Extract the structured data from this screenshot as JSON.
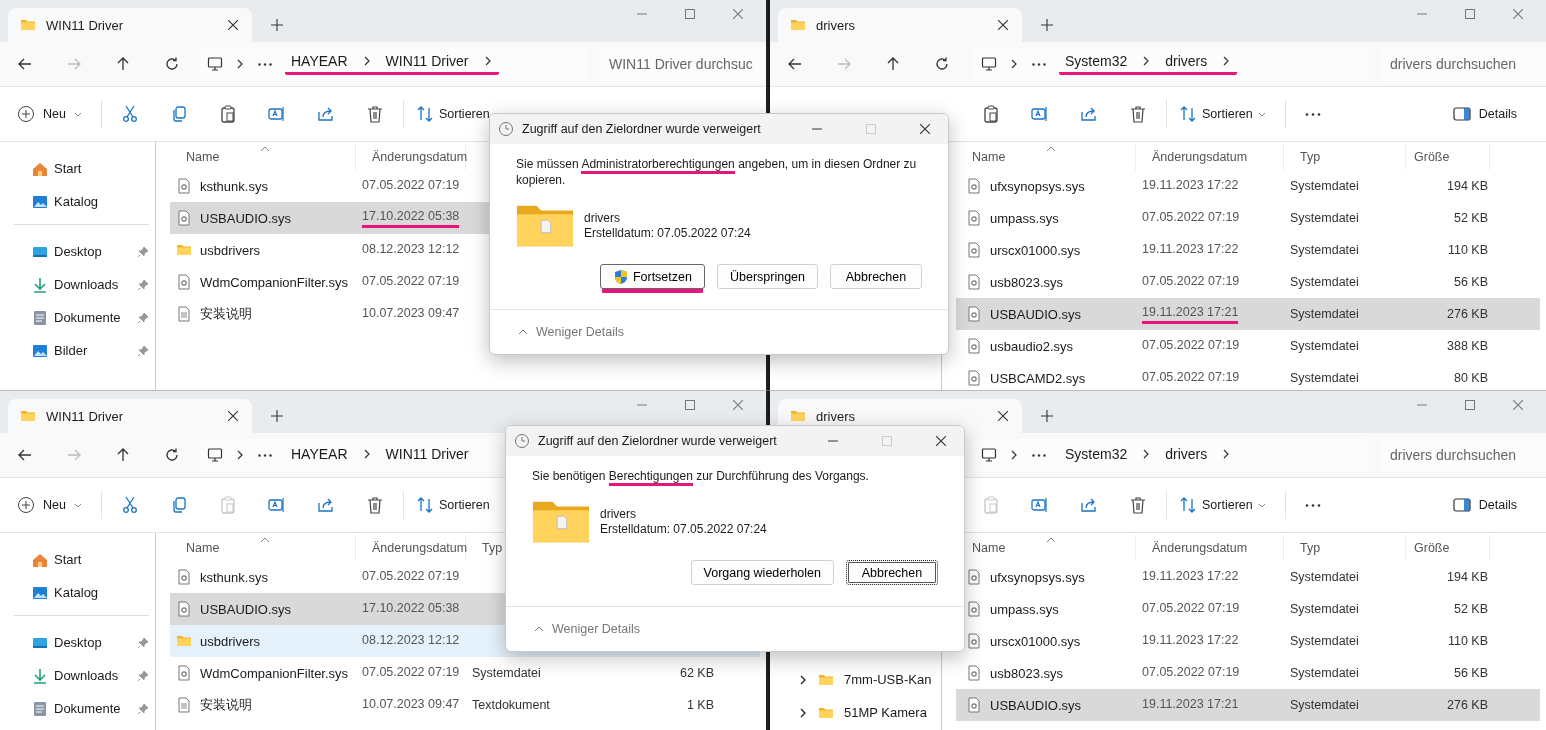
{
  "windows": [
    {
      "tab_title": "WIN11 Driver",
      "breadcrumb": {
        "items": [
          "HAYEAR",
          "WIN11 Driver"
        ],
        "trailing_chevron": true,
        "marked": true
      },
      "search_placeholder": "WIN11 Driver durchsuc",
      "toolbar": [
        {
          "kind": "new",
          "label": "Neu"
        },
        {
          "kind": "cut"
        },
        {
          "kind": "copy"
        },
        {
          "kind": "paste",
          "disabled": false
        },
        {
          "kind": "rename"
        },
        {
          "kind": "share"
        },
        {
          "kind": "delete"
        },
        {
          "kind": "sort",
          "label": "Sortieren"
        }
      ],
      "sidebar": [
        [
          {
            "label": "Start",
            "pinned": false
          },
          {
            "label": "Katalog",
            "pinned": false
          }
        ],
        [
          {
            "label": "Desktop",
            "pinned": true
          },
          {
            "label": "Downloads",
            "pinned": true
          },
          {
            "label": "Dokumente",
            "pinned": true
          },
          {
            "label": "Bilder",
            "pinned": true
          }
        ]
      ],
      "columns": [
        "Name",
        "Änderungsdatum"
      ],
      "rows": [
        {
          "name": "ksthunk.sys",
          "kind": "sys",
          "date": "07.05.2022 07:19",
          "selected": false,
          "hovered": false,
          "date_marked": false
        },
        {
          "name": "USBAUDIO.sys",
          "kind": "sys",
          "date": "17.10.2022 05:38",
          "selected": true,
          "hovered": false,
          "date_marked": true
        },
        {
          "name": "usbdrivers",
          "kind": "folder",
          "date": "08.12.2023 12:12",
          "selected": false,
          "hovered": false,
          "date_marked": false
        },
        {
          "name": "WdmCompanionFilter.sys",
          "kind": "sys",
          "date": "07.05.2022 07:19",
          "selected": false,
          "hovered": false,
          "date_marked": false
        },
        {
          "name": "安装说明",
          "kind": "text",
          "date": "10.07.2023 09:47",
          "selected": false,
          "hovered": false,
          "date_marked": false
        }
      ]
    },
    {
      "tab_title": "drivers",
      "breadcrumb": {
        "items": [
          "System32",
          "drivers"
        ],
        "trailing_chevron": true,
        "marked": true
      },
      "search_placeholder": "drivers durchsuchen",
      "toolbar": [
        {
          "kind": "paste",
          "disabled": false
        },
        {
          "kind": "rename"
        },
        {
          "kind": "share"
        },
        {
          "kind": "delete"
        },
        {
          "kind": "sort",
          "label": "Sortieren"
        },
        {
          "kind": "more"
        },
        {
          "kind": "details",
          "label": "Details"
        }
      ],
      "columns": [
        "Name",
        "Änderungsdatum",
        "Typ",
        "Größe"
      ],
      "rows": [
        {
          "name": "ufxsynopsys.sys",
          "kind": "sys",
          "date": "19.11.2023 17:22",
          "type": "Systemdatei",
          "size": "194 KB",
          "selected": false,
          "hovered": false,
          "date_marked": false
        },
        {
          "name": "umpass.sys",
          "kind": "sys",
          "date": "07.05.2022 07:19",
          "type": "Systemdatei",
          "size": "52 KB",
          "selected": false,
          "hovered": false,
          "date_marked": false
        },
        {
          "name": "urscx01000.sys",
          "kind": "sys",
          "date": "19.11.2023 17:22",
          "type": "Systemdatei",
          "size": "110 KB",
          "selected": false,
          "hovered": false,
          "date_marked": false
        },
        {
          "name": "usb8023.sys",
          "kind": "sys",
          "date": "07.05.2022 07:19",
          "type": "Systemdatei",
          "size": "56 KB",
          "selected": false,
          "hovered": false,
          "date_marked": false
        },
        {
          "name": "USBAUDIO.sys",
          "kind": "sys",
          "date": "19.11.2023 17:21",
          "type": "Systemdatei",
          "size": "276 KB",
          "selected": true,
          "hovered": false,
          "date_marked": true
        },
        {
          "name": "usbaudio2.sys",
          "kind": "sys",
          "date": "07.05.2022 07:19",
          "type": "Systemdatei",
          "size": "388 KB",
          "selected": false,
          "hovered": false,
          "date_marked": false
        },
        {
          "name": "USBCAMD2.sys",
          "kind": "sys",
          "date": "07.05.2022 07:19",
          "type": "Systemdatei",
          "size": "80 KB",
          "selected": false,
          "hovered": false,
          "date_marked": false
        }
      ]
    },
    {
      "tab_title": "WIN11 Driver",
      "breadcrumb": {
        "items": [
          "HAYEAR",
          "WIN11 Driver"
        ],
        "trailing_chevron": false,
        "marked": false
      },
      "toolbar": [
        {
          "kind": "new",
          "label": "Neu"
        },
        {
          "kind": "cut"
        },
        {
          "kind": "copy"
        },
        {
          "kind": "paste",
          "disabled": true
        },
        {
          "kind": "rename"
        },
        {
          "kind": "share"
        },
        {
          "kind": "delete"
        },
        {
          "kind": "sort",
          "label": "Sortieren"
        }
      ],
      "sidebar": [
        [
          {
            "label": "Start",
            "pinned": false
          },
          {
            "label": "Katalog",
            "pinned": false
          }
        ],
        [
          {
            "label": "Desktop",
            "pinned": true
          },
          {
            "label": "Downloads",
            "pinned": true
          },
          {
            "label": "Dokumente",
            "pinned": true
          }
        ]
      ],
      "columns": [
        "Name",
        "Änderungsdatum",
        "Typ"
      ],
      "rows": [
        {
          "name": "ksthunk.sys",
          "kind": "sys",
          "date": "07.05.2022 07:19",
          "selected": false,
          "hovered": false,
          "date_marked": false
        },
        {
          "name": "USBAUDIO.sys",
          "kind": "sys",
          "date": "17.10.2022 05:38",
          "selected": true,
          "hovered": false,
          "date_marked": false
        },
        {
          "name": "usbdrivers",
          "kind": "folder",
          "date": "08.12.2023 12:12",
          "selected": false,
          "hovered": true,
          "date_marked": false
        },
        {
          "name": "WdmCompanionFilter.sys",
          "kind": "sys",
          "date": "07.05.2022 07:19",
          "type": "Systemdatei",
          "size": "62 KB",
          "selected": false,
          "hovered": false,
          "date_marked": false
        },
        {
          "name": "安装说明",
          "kind": "text",
          "date": "10.07.2023 09:47",
          "type": "Textdokument",
          "size": "1 KB",
          "selected": false,
          "hovered": false,
          "date_marked": false
        }
      ]
    },
    {
      "tab_title": "drivers",
      "breadcrumb": {
        "items": [
          "System32",
          "drivers"
        ],
        "trailing_chevron": true,
        "marked": false
      },
      "search_placeholder": "drivers durchsuchen",
      "toolbar": [
        {
          "kind": "paste",
          "disabled": true
        },
        {
          "kind": "rename"
        },
        {
          "kind": "share"
        },
        {
          "kind": "delete"
        },
        {
          "kind": "sort",
          "label": "Sortieren"
        },
        {
          "kind": "more"
        },
        {
          "kind": "details",
          "label": "Details"
        }
      ],
      "sidebar": [
        [
          {
            "label": "7mm-USB-Kan",
            "pinned": false,
            "expandable": true
          },
          {
            "label": "51MP Kamera",
            "pinned": false,
            "expandable": true
          }
        ]
      ],
      "columns": [
        "Name",
        "Änderungsdatum",
        "Typ",
        "Größe"
      ],
      "rows": [
        {
          "name": "ufxsynopsys.sys",
          "kind": "sys",
          "date": "19.11.2023 17:22",
          "type": "Systemdatei",
          "size": "194 KB",
          "selected": false,
          "hovered": false,
          "date_marked": false
        },
        {
          "name": "umpass.sys",
          "kind": "sys",
          "date": "07.05.2022 07:19",
          "type": "Systemdatei",
          "size": "52 KB",
          "selected": false,
          "hovered": false,
          "date_marked": false
        },
        {
          "name": "urscx01000.sys",
          "kind": "sys",
          "date": "19.11.2023 17:22",
          "type": "Systemdatei",
          "size": "110 KB",
          "selected": false,
          "hovered": false,
          "date_marked": false
        },
        {
          "name": "usb8023.sys",
          "kind": "sys",
          "date": "07.05.2022 07:19",
          "type": "Systemdatei",
          "size": "56 KB",
          "selected": false,
          "hovered": false,
          "date_marked": false
        },
        {
          "name": "USBAUDIO.sys",
          "kind": "sys",
          "date": "19.11.2023 17:21",
          "type": "Systemdatei",
          "size": "276 KB",
          "selected": true,
          "hovered": false,
          "date_marked": false
        }
      ]
    }
  ],
  "dialogs": [
    {
      "title": "Zugriff auf den Zielordner wurde verweigert",
      "message": {
        "before": "Sie müssen ",
        "underlined": "Administratorberechtigungen",
        "after": " angeben, um in diesen Ordner zu kopieren."
      },
      "folder_name": "drivers",
      "folder_date": "Erstelldatum: 07.05.2022 07:24",
      "buttons": [
        {
          "label": "Fortsetzen",
          "shield": true,
          "default": false,
          "marked": true
        },
        {
          "label": "Überspringen",
          "shield": false,
          "default": false,
          "marked": false
        },
        {
          "label": "Abbrechen",
          "shield": false,
          "default": false,
          "marked": false
        }
      ],
      "details_toggle": "Weniger Details"
    },
    {
      "title": "Zugriff auf den Zielordner wurde verweigert",
      "message": {
        "before": "Sie benötigen ",
        "underlined": "Berechtigungen",
        "after": " zur Durchführung des Vorgangs."
      },
      "folder_name": "drivers",
      "folder_date": "Erstelldatum: 07.05.2022 07:24",
      "buttons": [
        {
          "label": "Vorgang wiederholen",
          "shield": false,
          "default": false,
          "marked": false
        },
        {
          "label": "Abbrechen",
          "shield": false,
          "default": true,
          "marked": false
        }
      ],
      "details_toggle": "Weniger Details"
    }
  ]
}
